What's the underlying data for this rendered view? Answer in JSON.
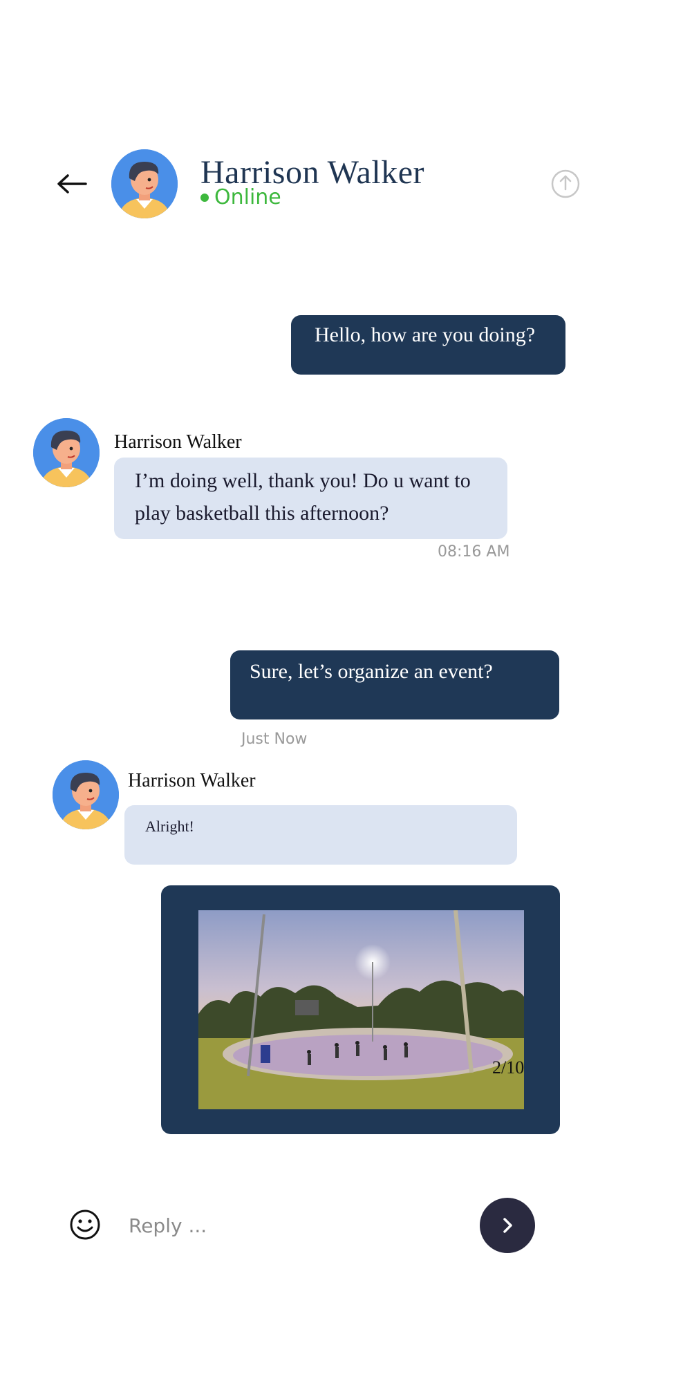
{
  "header": {
    "contact_name": "Harrison Walker",
    "status": "Online",
    "status_color": "#3db83d",
    "back_icon": "arrow-left-icon",
    "share_icon": "share-upload-icon"
  },
  "messages": [
    {
      "direction": "outgoing",
      "text": "Hello, how are you doing?"
    },
    {
      "direction": "incoming",
      "sender": "Harrison Walker",
      "text": "I’m doing well, thank you! Do u want to play basketball this afternoon?",
      "time": "08:16 AM"
    },
    {
      "direction": "outgoing",
      "text": "Sure, let’s organize an event?",
      "time": "Just Now"
    },
    {
      "direction": "incoming",
      "sender": "Harrison Walker",
      "text": "Alright!"
    },
    {
      "direction": "outgoing",
      "type": "photo",
      "counter": "2/10"
    }
  ],
  "reply": {
    "placeholder": "Reply ...",
    "emoji_icon": "smiley-icon",
    "send_icon": "chevron-right-icon"
  },
  "colors": {
    "outgoing_bubble": "#1f3856",
    "incoming_bubble": "#dce4f2",
    "send_button": "#2a2a40",
    "title": "#1f3552"
  }
}
